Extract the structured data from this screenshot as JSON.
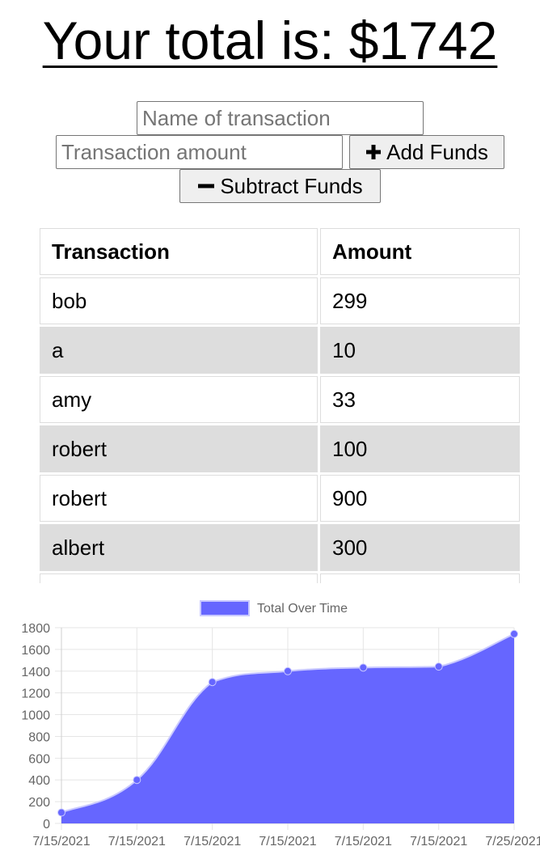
{
  "total": {
    "label": "Your total is: $",
    "value": "1742"
  },
  "form": {
    "name_placeholder": "Name of transaction",
    "amount_placeholder": "Transaction amount",
    "add_label": "Add Funds",
    "subtract_label": "Subtract Funds"
  },
  "table": {
    "headers": [
      "Transaction",
      "Amount"
    ],
    "rows": [
      {
        "name": "bob",
        "amount": "299"
      },
      {
        "name": "a",
        "amount": "10"
      },
      {
        "name": "amy",
        "amount": "33"
      },
      {
        "name": "robert",
        "amount": "100"
      },
      {
        "name": "robert",
        "amount": "900"
      },
      {
        "name": "albert",
        "amount": "300"
      },
      {
        "name": "",
        "amount": ""
      }
    ]
  },
  "colors": {
    "series_fill": "#6666ff",
    "grid": "#e5e5e5",
    "tick_text": "#666666"
  },
  "chart_data": {
    "type": "area",
    "title": "",
    "legend": "top",
    "xlabel": "",
    "ylabel": "",
    "categories": [
      "7/15/2021",
      "7/15/2021",
      "7/15/2021",
      "7/15/2021",
      "7/15/2021",
      "7/15/2021",
      "7/25/2021"
    ],
    "series": [
      {
        "name": "Total Over Time",
        "values": [
          100,
          400,
          1300,
          1400,
          1433,
          1442,
          1742
        ]
      }
    ],
    "ylim": [
      0,
      1800
    ],
    "yticks": [
      0,
      200,
      400,
      600,
      800,
      1000,
      1200,
      1400,
      1600,
      1800
    ],
    "grid": true
  }
}
